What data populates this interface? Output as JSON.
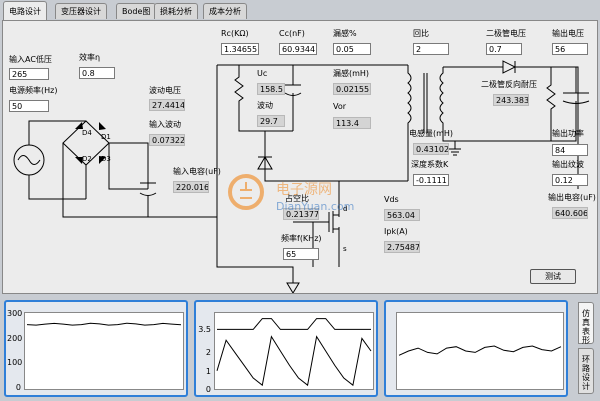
{
  "tabs": [
    {
      "label": "电路设计",
      "active": true
    },
    {
      "label": "变压器设计",
      "active": false
    },
    {
      "label": "Bode图",
      "active": false
    },
    {
      "label": "损耗分析",
      "active": false
    },
    {
      "label": "成本分析",
      "active": false
    }
  ],
  "inputs": {
    "ac_min_label": "输入AC低压",
    "ac_min": "265",
    "freq_label": "电源频率(Hz)",
    "freq": "50",
    "eff_label": "效率η",
    "eff": "0.8",
    "ripple_v_label": "波动电压",
    "ripple_v": "27.4414",
    "ripple_in_label": "输入波动",
    "ripple_in": "0.07322",
    "cin_label": "输入电容(uF)",
    "cin": "220.016",
    "rc_label": "Rc(KΩ)",
    "rc": "1.34655",
    "cc_label": "Cc(nF)",
    "cc": "60.9344",
    "leak_pct_label": "漏感%",
    "leak_pct": "0.05",
    "leak_mh_label": "漏感(mH)",
    "leak_mh": "0.02155",
    "vor_label": "Vor",
    "vor": "113.4",
    "uc_label": "Uc",
    "uc": "158.5",
    "ripple_label": "波动",
    "ripple": "29.7",
    "turns_label": "回比",
    "turns": "2",
    "lm_label": "电感量(mH)",
    "lm": "0.43102",
    "depth_label": "深度系数K",
    "depth": "-0.1111",
    "diode_v_label": "二极管电压",
    "diode_v": "0.7",
    "diode_rev_label": "二极管反向耐压",
    "diode_rev": "243.383",
    "vout_label": "输出电压",
    "vout": "56",
    "pout_label": "输出功率",
    "pout": "84",
    "out_ripple_label": "输出纹波",
    "out_ripple": "0.12",
    "cout_label": "输出电容(uF)",
    "cout": "640.606",
    "duty_label": "占空比",
    "duty": "0.21377",
    "vds_label": "Vds",
    "vds": "563.04",
    "ipk_label": "Ipk(A)",
    "ipk": "2.75487",
    "fsw_label": "频率f(KHz)",
    "fsw": "65"
  },
  "schematic": {
    "d": "D1",
    "d2": "D2",
    "d3": "D3",
    "d4": "D4",
    "pin_d": "d",
    "pin_s": "s"
  },
  "test_button": "测试",
  "side_tabs": [
    "仿真表形",
    "环路设计"
  ],
  "watermark": {
    "cn": "电子源网",
    "en": "DianYuan.com"
  },
  "chart_data": [
    {
      "type": "line",
      "title": "",
      "yticks": [
        "300",
        "200",
        "100",
        "0"
      ],
      "ylim": [
        0,
        300
      ],
      "series": [
        {
          "values": [
            260,
            258,
            262,
            265,
            262,
            258,
            260,
            266,
            263,
            258,
            260,
            266,
            263,
            258,
            260,
            265,
            262,
            259
          ]
        }
      ]
    },
    {
      "type": "line",
      "title": "",
      "yticks": [
        "3.5",
        "2",
        "1",
        "0"
      ],
      "ylim": [
        0,
        4
      ],
      "series": [
        {
          "name": "pulse",
          "values": [
            3.2,
            3.2,
            3.2,
            3.2,
            3.2,
            3.8,
            3.8,
            3.2,
            3.2,
            3.2,
            3.2,
            3.8,
            3.8,
            3.2,
            3.2,
            3.2,
            3.2,
            3.2
          ]
        },
        {
          "name": "sawtooth",
          "values": [
            0.9,
            2.6,
            1.9,
            1.2,
            0.5,
            0.1,
            2.8,
            2.0,
            1.2,
            0.5,
            0.1,
            2.8,
            2.0,
            1.2,
            0.5,
            0.1,
            2.7,
            2.0
          ]
        }
      ]
    },
    {
      "type": "line",
      "title": "",
      "yticks": [],
      "ylim": [
        0,
        100
      ],
      "series": [
        {
          "values": [
            44,
            50,
            54,
            48,
            46,
            54,
            56,
            50,
            48,
            55,
            57,
            51,
            49,
            55,
            57,
            52,
            50,
            56
          ]
        }
      ]
    }
  ]
}
